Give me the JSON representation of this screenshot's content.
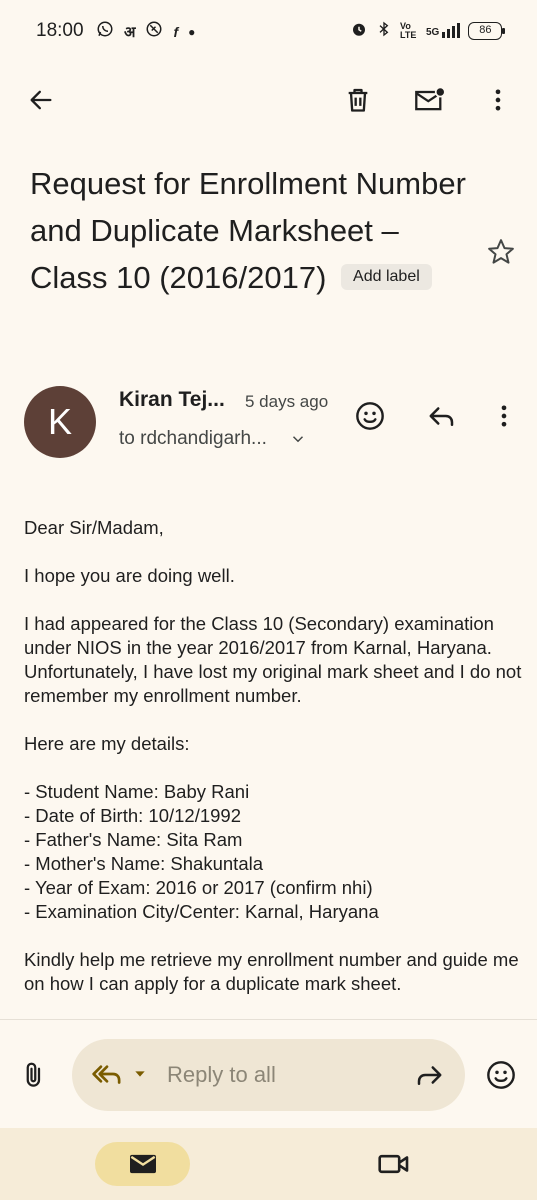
{
  "status_bar": {
    "time": "18:00",
    "left_icons": [
      "whatsapp-icon",
      "hindi-keyboard-icon",
      "vpn-icon",
      "flipkart-icon",
      "dot-icon"
    ],
    "right_icons": [
      "alarm-icon",
      "bluetooth-icon",
      "volte-icon",
      "signal-5g-icon"
    ],
    "volte_label": "Vo LTE",
    "network_label": "5G",
    "battery": "86"
  },
  "toolbar": {
    "back_icon": "arrow-back-icon",
    "delete_icon": "trash-icon",
    "mark_unread_icon": "mail-unread-icon",
    "more_icon": "more-vert-icon"
  },
  "email": {
    "subject": "Request for Enrollment Number and Duplicate Marksheet – Class 10 (2016/2017)",
    "add_label": "Add label",
    "sender": {
      "initial": "K",
      "name": "Kiran Tej...",
      "time": "5 days ago",
      "to": "to rdchandigarh..."
    },
    "body": {
      "greeting": "Dear Sir/Madam,",
      "intro": "I hope you are doing well.",
      "para1": "I had appeared for the Class 10 (Secondary) examination under NIOS in the year 2016/2017 from Karnal, Haryana. Unfortunately, I have lost my original mark sheet and I do not remember my enrollment number.",
      "details_heading": "Here are my details:",
      "details": [
        "- Student Name: Baby Rani",
        "- Date of Birth: 10/12/1992",
        "- Father's Name: Sita Ram",
        "- Mother's Name: Shakuntala",
        "- Year of Exam: 2016 or 2017 (confirm nhi)",
        "- Examination City/Center: Karnal, Haryana"
      ],
      "closing": "Kindly help me retrieve my enrollment number and guide me on how I can apply for a duplicate mark sheet."
    }
  },
  "reply_bar": {
    "placeholder": "Reply to all"
  },
  "bottom_nav": {
    "items": [
      "mail-icon",
      "video-icon"
    ]
  },
  "colors": {
    "background": "#fdf8f0",
    "avatar": "#5d4037",
    "reply_pill": "#efe6d4",
    "reply_icon": "#7a5c00",
    "nav_active": "#f1de9f"
  }
}
